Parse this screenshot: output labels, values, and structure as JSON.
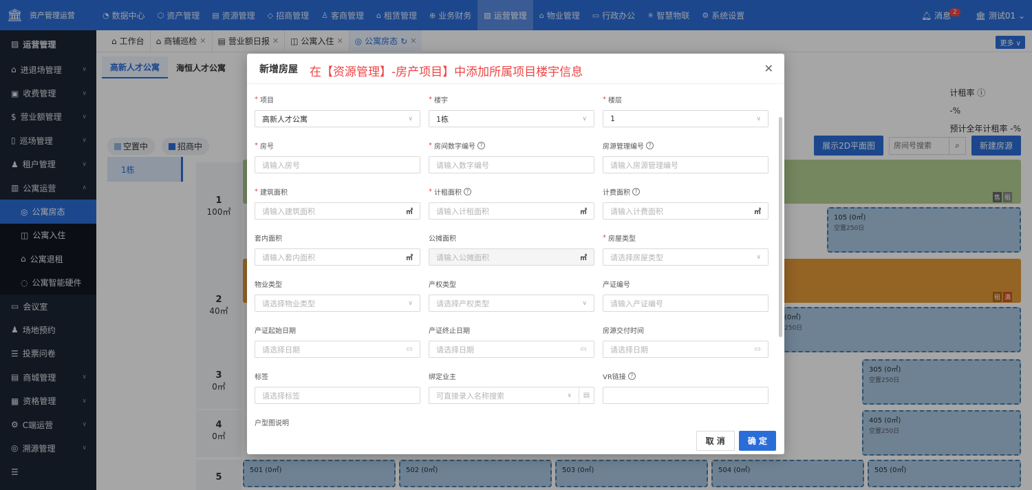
{
  "topbar": {
    "app_title": "资产管理运营",
    "nav": [
      {
        "icon": "◔",
        "label": "数据中心"
      },
      {
        "icon": "⬡",
        "label": "资产管理"
      },
      {
        "icon": "▤",
        "label": "资源管理"
      },
      {
        "icon": "◇",
        "label": "招商管理"
      },
      {
        "icon": "♙",
        "label": "客商管理"
      },
      {
        "icon": "⌂",
        "label": "租赁管理"
      },
      {
        "icon": "⊕",
        "label": "业务财务"
      },
      {
        "icon": "▨",
        "label": "运营管理"
      },
      {
        "icon": "⌂",
        "label": "物业管理"
      },
      {
        "icon": "▭",
        "label": "行政办公"
      },
      {
        "icon": "✳",
        "label": "智慧物联"
      },
      {
        "icon": "⚙",
        "label": "系统设置"
      }
    ],
    "message_label": "消息",
    "message_count": "2",
    "user": "测试01"
  },
  "sidebar": {
    "header": "运营管理",
    "items": [
      {
        "label": "进退场管理"
      },
      {
        "label": "收费管理"
      },
      {
        "label": "营业额管理"
      },
      {
        "label": "巡场管理"
      },
      {
        "label": "租户管理"
      },
      {
        "label": "公寓运营"
      },
      {
        "label": "公寓房态"
      },
      {
        "label": "公寓入住"
      },
      {
        "label": "公寓退租"
      },
      {
        "label": "公寓智能硬件"
      },
      {
        "label": "会议室"
      },
      {
        "label": "场地预约"
      },
      {
        "label": "投票问卷"
      },
      {
        "label": "商城管理"
      },
      {
        "label": "资格管理"
      },
      {
        "label": "C端运营"
      },
      {
        "label": "溯源管理"
      }
    ]
  },
  "tabs": [
    {
      "label": "工作台"
    },
    {
      "label": "商铺巡检"
    },
    {
      "label": "营业额日报"
    },
    {
      "label": "公寓入住"
    },
    {
      "label": "公寓房态"
    }
  ],
  "more_label": "更多",
  "page": {
    "project_tabs": [
      "高新人才公寓",
      "海恒人才公寓"
    ],
    "stats": {
      "rate_label": "计租率",
      "rate_value": "-%",
      "year_label": "预计全年计租率 -%"
    },
    "legend": [
      {
        "label": "空置中",
        "color": "#8fb8de"
      },
      {
        "label": "招商中",
        "color": "#2b6dd8"
      }
    ],
    "btn_2d": "展示2D平面图",
    "search_placeholder": "房间号搜索",
    "btn_new": "新建房源",
    "building": "1栋",
    "floors": [
      {
        "num": "1",
        "area": "100㎡"
      },
      {
        "num": "2",
        "area": "40㎡"
      },
      {
        "num": "3",
        "area": "0㎡"
      },
      {
        "num": "4",
        "area": "0㎡"
      },
      {
        "num": "5",
        "area": ""
      }
    ],
    "tags": {
      "sell": "售",
      "rent": "租",
      "rent2": "租",
      "full": "满"
    },
    "rooms": [
      {
        "name": "105 (0㎡)",
        "status": "空置250日"
      },
      {
        "name": "(0㎡)",
        "status": "250日"
      },
      {
        "name": "305 (0㎡)",
        "status": "空置250日"
      },
      {
        "name": "405 (0㎡)",
        "status": "空置250日"
      },
      {
        "name": "501 (0㎡)",
        "status": ""
      },
      {
        "name": "502 (0㎡)",
        "status": ""
      },
      {
        "name": "503 (0㎡)",
        "status": ""
      },
      {
        "name": "504 (0㎡)",
        "status": ""
      },
      {
        "name": "505 (0㎡)",
        "status": ""
      }
    ]
  },
  "modal": {
    "title": "新增房屋",
    "note": "在【资源管理】-房产项目】中添加所属项目楼宇信息",
    "fields": {
      "project": {
        "label": "项目",
        "value": "高新人才公寓"
      },
      "building": {
        "label": "楼宇",
        "value": "1栋"
      },
      "floor": {
        "label": "楼层",
        "value": "1"
      },
      "room_no": {
        "label": "房号",
        "placeholder": "请输入房号"
      },
      "room_num_code": {
        "label": "房间数字编号",
        "placeholder": "请输入数字编号"
      },
      "room_mgmt_code": {
        "label": "房源管理编号",
        "placeholder": "请输入房源管理编号"
      },
      "build_area": {
        "label": "建筑面积",
        "placeholder": "请输入建筑面积",
        "unit": "㎡"
      },
      "rent_area": {
        "label": "计租面积",
        "placeholder": "请输入计租面积",
        "unit": "㎡"
      },
      "fee_area": {
        "label": "计费面积",
        "placeholder": "请输入计费面积",
        "unit": "㎡"
      },
      "inner_area": {
        "label": "套内面积",
        "placeholder": "请输入套内面积",
        "unit": "㎡"
      },
      "share_area": {
        "label": "公摊面积",
        "placeholder": "请输入公摊面积",
        "unit": "㎡"
      },
      "room_type": {
        "label": "房屋类型",
        "placeholder": "请选择房屋类型"
      },
      "property_type": {
        "label": "物业类型",
        "placeholder": "请选择物业类型"
      },
      "ownership_type": {
        "label": "产权类型",
        "placeholder": "请选择产权类型"
      },
      "cert_no": {
        "label": "产证编号",
        "placeholder": "请输入产证编号"
      },
      "cert_start": {
        "label": "产证起始日期",
        "placeholder": "请选择日期"
      },
      "cert_end": {
        "label": "产证终止日期",
        "placeholder": "请选择日期"
      },
      "deliver_time": {
        "label": "房源交付时间",
        "placeholder": "请选择日期"
      },
      "tags": {
        "label": "标签",
        "placeholder": "请选择标签"
      },
      "owner": {
        "label": "绑定业主",
        "placeholder": "可直接录入名称搜索"
      },
      "vr": {
        "label": "VR链接",
        "placeholder": ""
      },
      "layout_desc": {
        "label": "户型图说明"
      }
    },
    "cancel": "取 消",
    "ok": "确 定"
  }
}
